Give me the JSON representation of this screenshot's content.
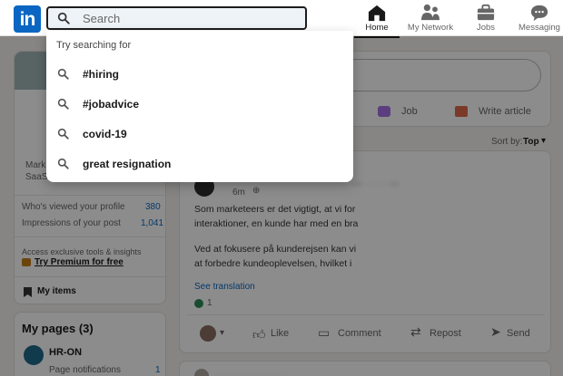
{
  "nav": {
    "logo_text": "in",
    "search": {
      "placeholder": "Search",
      "value": ""
    },
    "items": [
      {
        "label": "Home",
        "icon": "home-icon"
      },
      {
        "label": "My Network",
        "icon": "network-icon"
      },
      {
        "label": "Jobs",
        "icon": "briefcase-icon"
      },
      {
        "label": "Messaging",
        "icon": "chat-icon"
      }
    ]
  },
  "search_dropdown": {
    "hint": "Try searching for",
    "suggestions": [
      "#hiring",
      "#jobadvice",
      "covid-19",
      "great resignation"
    ]
  },
  "left_profile": {
    "headline_lines": [
      "Mark",
      "SaaS"
    ],
    "stats": [
      {
        "label": "Who's viewed your profile",
        "value": "380"
      },
      {
        "label": "Impressions of your post",
        "value": "1,041"
      }
    ],
    "premium_note": "Access exclusive tools & insights",
    "premium_link": "Try Premium for free",
    "my_items": "My items"
  },
  "my_pages": {
    "title": "My pages (3)",
    "page_name": "HR-ON",
    "page_sub": "Page notifications",
    "page_count": "1"
  },
  "share_box": {
    "job_label": "Job",
    "write_article_label": "Write article"
  },
  "feed": {
    "sort_label": "Sort by:",
    "sort_value": "Top",
    "post_time": "6m",
    "post_p1_lines": [
      "Som marketeers er det vigtigt, at vi for",
      "interaktioner, en kunde har med en bra"
    ],
    "post_p2_lines": [
      "Ved at fokusere på kunderejsen kan vi",
      "at forbedre kundeoplevelsen, hvilket i"
    ],
    "see_translation": "See translation",
    "reaction_count": "1",
    "actions": [
      "Like",
      "Comment",
      "Repost",
      "Send"
    ]
  },
  "colors": {
    "brand": "#0a66c2",
    "premium": "#c37d16"
  }
}
